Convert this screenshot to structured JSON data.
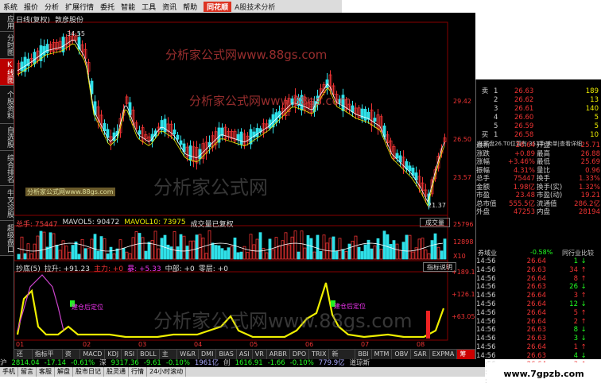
{
  "menubar": {
    "items": [
      "系统",
      "报价",
      "分析",
      "扩展行情",
      "委托",
      "智能",
      "工具",
      "资讯",
      "帮助"
    ],
    "logo": "同花顺",
    "app_title": "A股技术分析"
  },
  "nav": {
    "items": [
      "应用",
      "分时图",
      "K线图",
      "个股资料",
      "自选股",
      "综合排名",
      "牛叉诊股",
      "超级盘口"
    ],
    "active_index": 2
  },
  "stock": {
    "period": "日线(复权)",
    "name": "敦彦股份"
  },
  "price_axis": [
    "29.42",
    "26.50",
    "23.57"
  ],
  "price_high": "34.55",
  "price_low": "21.37",
  "price_label_current": "26.50",
  "watermark": {
    "line1": "分析家公式网www.88gs.com",
    "line2": "分析家公式网www.88gs.com",
    "large1": "分析家公式网",
    "large2": "分析家公式网www.88gs.com",
    "badge": "分析家公式网www.88gs.com"
  },
  "volume": {
    "title": "总手: 75447",
    "mavol5": "MAVOL5: 90472",
    "mavol10": "MAVOL10: 73975",
    "note": "成交量已复权",
    "button": "成交量",
    "axis": [
      "25796",
      "12898",
      "X10"
    ]
  },
  "indicator": {
    "name": "抄底(5)",
    "items": [
      "拉升: +91.23",
      "主力: +0",
      "暴: +5.33",
      "中部: +0",
      "零层: +0"
    ],
    "button": "指标说明",
    "axis": [
      "+189.1",
      "+126.1",
      "+63.05"
    ],
    "labels": [
      "建仓后定位",
      "建仓后定位"
    ]
  },
  "x_axis": [
    "01",
    "02",
    "03",
    "04",
    "05",
    "06",
    "07",
    "08"
  ],
  "tabs": [
    "还手",
    "指标平台",
    "资讯",
    "MACD",
    "KDJ",
    "RSI",
    "BOLL",
    "主力",
    "W&R",
    "DMI",
    "BIAS",
    "ASI",
    "VR",
    "ARBR",
    "DPO",
    "TRIX",
    "新DMA",
    "BBI",
    "MTM",
    "OBV",
    "SAR",
    "EXPMA",
    "筹码"
  ],
  "tabs_active": 22,
  "quote": {
    "sell_side": "卖",
    "buy_side": "买",
    "side_sub": "盘",
    "orderbook": [
      {
        "s": "卖",
        "i": "1",
        "p": "26.63",
        "v": "189"
      },
      {
        "s": "",
        "i": "2",
        "p": "26.62",
        "v": "13"
      },
      {
        "s": "",
        "i": "3",
        "p": "26.61",
        "v": "140"
      },
      {
        "s": "",
        "i": "4",
        "p": "26.60",
        "v": "5"
      },
      {
        "s": "",
        "i": "5",
        "p": "26.59",
        "v": "5"
      },
      {
        "s": "买",
        "i": "1",
        "p": "26.58",
        "v": "10"
      }
    ],
    "header": "在买盘26.T0位置有  351手  卖单|查看详细",
    "fin": [
      {
        "k1": "最新",
        "v1": "26.64",
        "k2": "开盘",
        "v2": "25.71"
      },
      {
        "k1": "涨跌",
        "v1": "+0.89",
        "k2": "最高",
        "v2": "26.88"
      },
      {
        "k1": "涨幅",
        "v1": "+3.46%",
        "k2": "最低",
        "v2": "25.69"
      },
      {
        "k1": "振幅",
        "v1": "4.31%",
        "k2": "量比",
        "v2": "0.96"
      },
      {
        "k1": "总手",
        "v1": "75447",
        "k2": "换手",
        "v2": "1.33%"
      },
      {
        "k1": "金额",
        "v1": "1.98亿",
        "k2": "换手(实)",
        "v2": "1.32%"
      },
      {
        "k1": "市盈",
        "v1": "23.48",
        "k2": "市盈(动)",
        "v2": "19.21"
      },
      {
        "k1": "总市值",
        "v1": "555.5亿",
        "k2": "流通值",
        "v2": "286.2亿"
      },
      {
        "k1": "外盘",
        "v1": "47253",
        "k2": "内盘",
        "v2": "28194"
      }
    ],
    "industry": {
      "k": "券域业",
      "v": "-0.58%",
      "link": "同行业比较"
    },
    "ticks": [
      {
        "tm": "14:56",
        "tp": "26.64",
        "tv": "1",
        "ta": "↓"
      },
      {
        "tm": "14:56",
        "tp": "26.63",
        "tv": "34",
        "ta": "↑"
      },
      {
        "tm": "14:56",
        "tp": "26.64",
        "tv": "8",
        "ta": "↑"
      },
      {
        "tm": "14:56",
        "tp": "26.63",
        "tv": "26",
        "ta": "↓"
      },
      {
        "tm": "14:56",
        "tp": "26.64",
        "tv": "3",
        "ta": "↑"
      },
      {
        "tm": "14:56",
        "tp": "26.64",
        "tv": "12",
        "ta": "↓"
      },
      {
        "tm": "14:56",
        "tp": "26.64",
        "tv": "5",
        "ta": "↑"
      },
      {
        "tm": "14:56",
        "tp": "26.64",
        "tv": "2",
        "ta": "↑"
      },
      {
        "tm": "14:56",
        "tp": "26.63",
        "tv": "8",
        "ta": "↓"
      },
      {
        "tm": "14:56",
        "tp": "26.63",
        "tv": "3",
        "ta": "↓"
      },
      {
        "tm": "14:56",
        "tp": "26.64",
        "tv": "1",
        "ta": "↑"
      },
      {
        "tm": "14:56",
        "tp": "26.63",
        "tv": "4",
        "ta": "↓"
      },
      {
        "tm": "14:56",
        "tp": "26.64",
        "tv": "3",
        "ta": "↑"
      },
      {
        "tm": "14:56",
        "tp": "26.63",
        "tv": "15",
        "ta": "↓"
      },
      {
        "tm": "15:00",
        "tp": "26.64",
        "tv": "1290",
        "ta": "↓"
      }
    ]
  },
  "status": {
    "a": "沪",
    "b": "2814.04",
    "c": "-17.14",
    "d": "-0.61%",
    "e": "深",
    "f": "9317.36",
    "g": "-9.61",
    "h": "-0.10%",
    "i": "1961亿",
    "j": "创",
    "k": "1616.91",
    "l": "-1.66",
    "m": "-0.10%",
    "n": "779.9亿",
    "o": "道琼斯"
  },
  "bottombar": [
    "手机",
    "留言",
    "客服",
    "解盘",
    "股市日记",
    "股灵通",
    "行情",
    "24小时滚动"
  ],
  "site": "www.7gpzb.com",
  "colors": {
    "up": "#e33",
    "down": "#2fe0e8",
    "bg": "#000",
    "accent": "#ee0"
  }
}
